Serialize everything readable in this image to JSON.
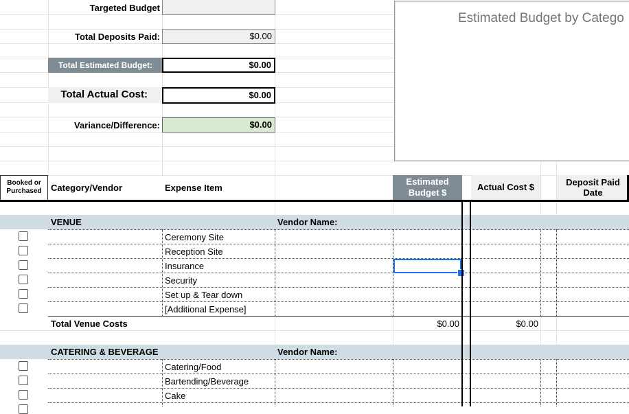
{
  "summary": {
    "targeted_budget_label": "Targeted Budget",
    "targeted_budget_value": "",
    "total_deposits_label": "Total Deposits Paid:",
    "total_deposits_value": "$0.00",
    "total_estimated_label": "Total Estimated Budget:",
    "total_estimated_value": "$0.00",
    "total_actual_label": "Total Actual Cost:",
    "total_actual_value": "$0.00",
    "variance_label": "Variance/Difference:",
    "variance_value": "$0.00"
  },
  "chart": {
    "title": "Estimated Budget by Catego"
  },
  "columns": {
    "booked": "Booked or Purchased",
    "category": "Category/Vendor",
    "expense": "Expense Item",
    "estimated": "Estimated Budget $",
    "actual": "Actual Cost $",
    "deposit_date": "Deposit Paid Date"
  },
  "sections": [
    {
      "name": "VENUE",
      "vendor_label": "Vendor Name:",
      "items": [
        "Ceremony Site",
        "Reception Site",
        "Insurance",
        "Security",
        "Set up & Tear down",
        "[Additional Expense]"
      ],
      "total_label": "Total Venue Costs",
      "total_estimated": "$0.00",
      "total_actual": "$0.00"
    },
    {
      "name": "CATERING & BEVERAGE",
      "vendor_label": "Vendor Name:",
      "items": [
        "Catering/Food",
        "Bartending/Beverage",
        "Cake"
      ]
    }
  ],
  "colors": {
    "section_bg": "#cfdce3",
    "header_dark": "#7f8c94",
    "header_light": "#eef0f2",
    "variance_bg": "#d9ead3",
    "selection": "#1a73e8"
  }
}
